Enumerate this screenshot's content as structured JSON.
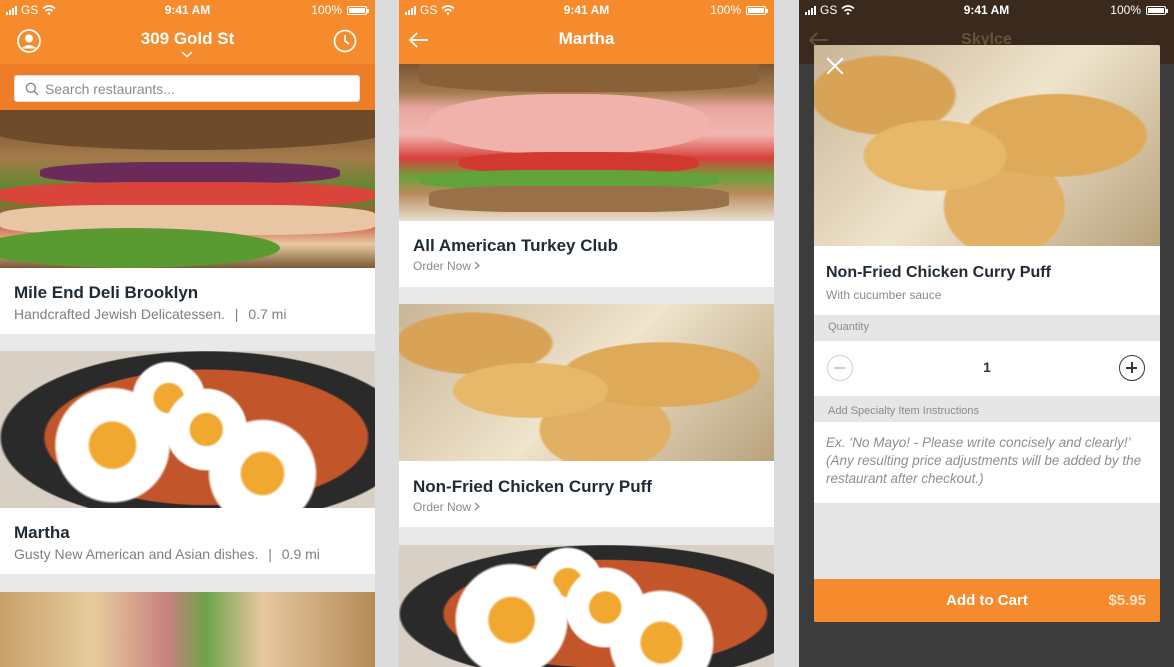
{
  "status": {
    "carrier": "GS",
    "time": "9:41 AM",
    "battery": "100%"
  },
  "screen1": {
    "address": "309 Gold St",
    "search_placeholder": "Search restaurants...",
    "restaurants": [
      {
        "name": "Mile End Deli Brooklyn",
        "description": "Handcrafted Jewish Delicatessen.",
        "distance": "0.7 mi"
      },
      {
        "name": "Martha",
        "description": "Gusty New American and Asian dishes.",
        "distance": "0.9 mi"
      }
    ],
    "separator": "|"
  },
  "screen2": {
    "title": "Martha",
    "items": [
      {
        "name": "All American Turkey Club",
        "action": "Order Now"
      },
      {
        "name": "Non-Fried Chicken Curry Puff",
        "action": "Order Now"
      }
    ]
  },
  "screen3": {
    "background_title": "Skylce",
    "item_name": "Non-Fried Chicken Curry Puff",
    "item_description": "With cucumber sauce",
    "quantity_label": "Quantity",
    "quantity": "1",
    "instructions_label": "Add Specialty Item Instructions",
    "instructions_placeholder": "Ex. ‘No Mayo! - Please write concisely and clearly!’ (Any resulting price adjustments will be added by the restaurant after checkout.)",
    "add_button": "Add to Cart",
    "price": "$5.95"
  },
  "colors": {
    "accent": "#f58b2d",
    "text_dark": "#1f2a35",
    "text_muted": "#7f7f7f"
  }
}
